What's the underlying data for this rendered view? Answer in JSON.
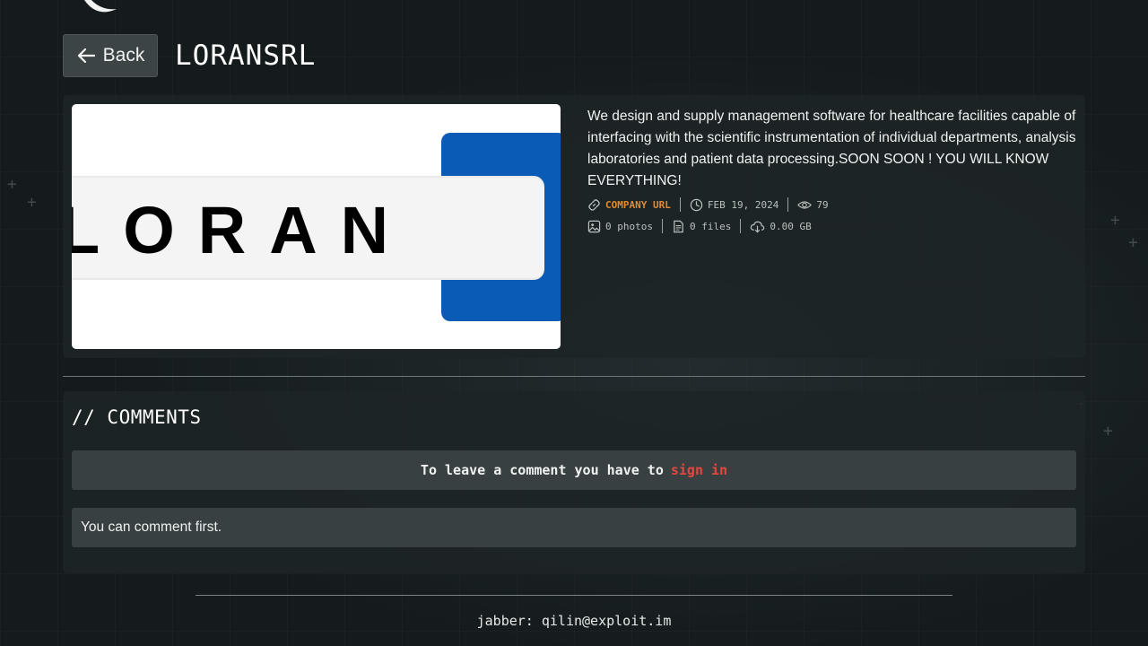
{
  "header": {
    "back_label": "Back",
    "title": "LORANSRL"
  },
  "company": {
    "logo_text": "LORAN",
    "description": "We design and supply management software for healthcare facilities capable of interfacing with the scientific instrumentation of individual departments, analysis laboratories and patient data processing.SOON SOON ! YOU WILL KNOW EVERYTHING!",
    "url_label": "COMPANY URL",
    "date": "FEB 19, 2024",
    "views": "79",
    "photos": "0 photos",
    "files": "0 files",
    "size": "0.00 GB"
  },
  "comments": {
    "title": "// COMMENTS",
    "signin_prompt": "To leave a comment you have to",
    "signin_link": "sign in",
    "empty_message": "You can comment first."
  },
  "footer": {
    "contact": "jabber: qilin@exploit.im"
  },
  "colors": {
    "accent_orange": "#e58a2b",
    "accent_red": "#e2483f",
    "logo_blue": "#0a5bb5"
  }
}
